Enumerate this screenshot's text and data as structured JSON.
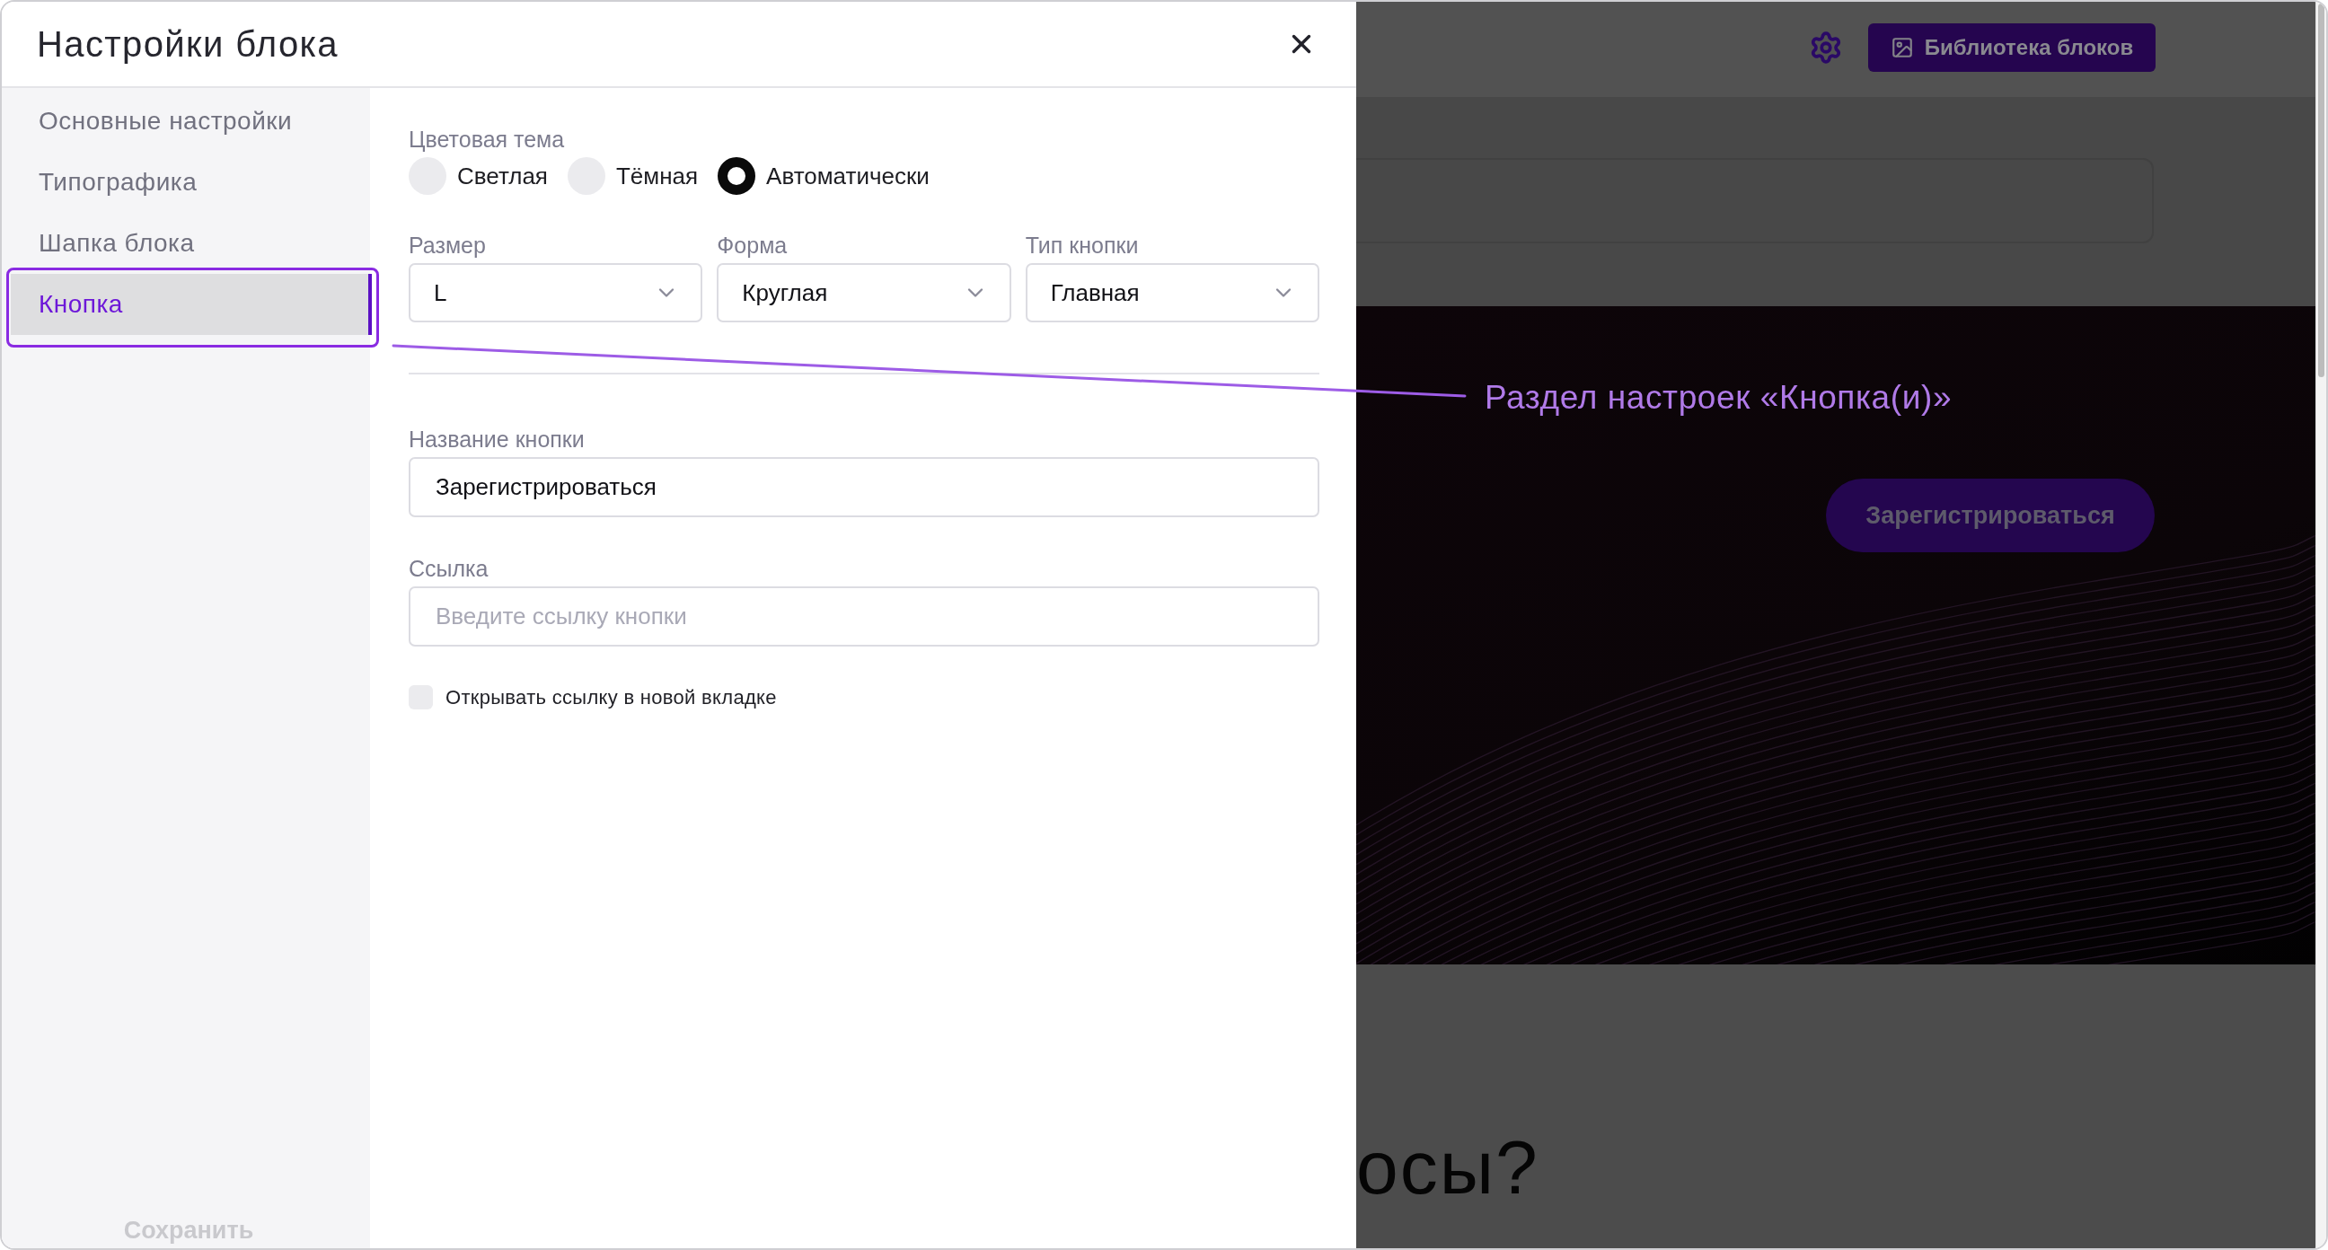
{
  "modal": {
    "title": "Настройки блока",
    "sidebar": {
      "items": [
        {
          "label": "Основные настройки",
          "selected": false,
          "highlighted": false
        },
        {
          "label": "Типографика",
          "selected": false,
          "highlighted": false
        },
        {
          "label": "Шапка блока",
          "selected": false,
          "highlighted": false
        },
        {
          "label": "Кнопка",
          "selected": true,
          "highlighted": true
        }
      ],
      "save_button": {
        "label": "Сохранить"
      }
    },
    "color_theme": {
      "label": "Цветовая тема",
      "options": [
        {
          "label": "Светлая",
          "selected": false
        },
        {
          "label": "Тёмная",
          "selected": false
        },
        {
          "label": "Автоматически",
          "selected": true
        }
      ]
    },
    "selects": [
      {
        "label": "Размер",
        "value": "L"
      },
      {
        "label": "Форма",
        "value": "Круглая"
      },
      {
        "label": "Тип кнопки",
        "value": "Главная"
      }
    ],
    "button_name": {
      "label": "Название кнопки",
      "value": "Зарегистрироваться"
    },
    "link": {
      "label": "Ссылка",
      "placeholder": "Введите ссылку кнопки"
    },
    "new_tab": {
      "label": "Открывать ссылку в новой вкладке",
      "checked": false
    }
  },
  "background_page": {
    "library_button": "Библиотека блоков",
    "hero_button": "Зарегистрироваться",
    "heading": "осы?"
  },
  "annotation": {
    "text": "Раздел настроек «Кнопка(и)»"
  }
}
